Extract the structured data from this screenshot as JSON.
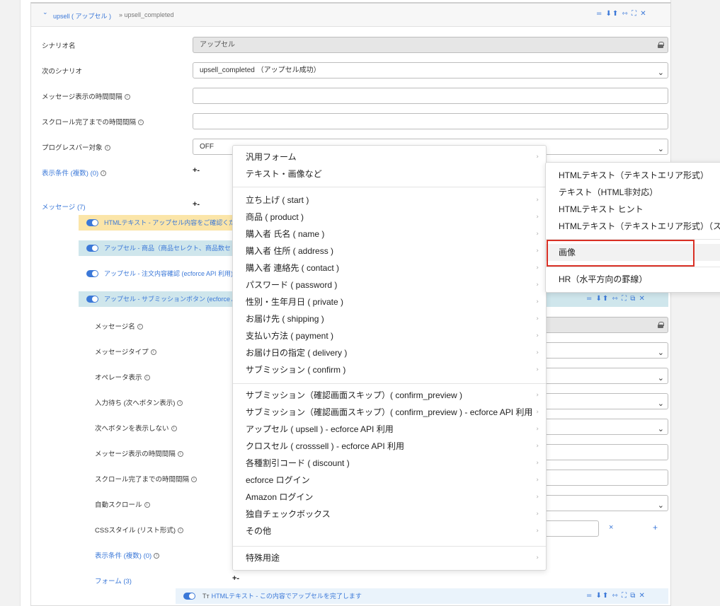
{
  "header": {
    "title": "upsell ( アップセル )",
    "sub": "» upsell_completed",
    "icons": "= ⬇⬆ ⇿ ⛶ ✕"
  },
  "fields": {
    "scenario_name_label": "シナリオ名",
    "scenario_name_value": "アップセル",
    "next_scenario_label": "次のシナリオ",
    "next_scenario_value": "upsell_completed （アップセル成功）",
    "msg_interval_label": "メッセージ表示の時間間隔",
    "scroll_interval_label": "スクロール完了までの時間間隔",
    "progress_label": "プログレスバー対象",
    "progress_value": "OFF",
    "display_cond_label": "表示条件 (複数) (0)",
    "messages_label": "メッセージ (7)"
  },
  "messages": [
    {
      "text": "HTMLテキスト - アップセル内容をご確認くだ",
      "bg": "#fbe5a8"
    },
    {
      "text": "アップセル - 商品（商品セレクト、商品数セレ",
      "bg": "#cfe6ec"
    },
    {
      "text": "アップセル - 注文内容確認 (ecforce API 利用)",
      "bg": "#ffffff"
    },
    {
      "text": "アップセル - サブミッションボタン (ecforce A",
      "bg": "#cfe6ec"
    }
  ],
  "detail": {
    "msg_name": "メッセージ名",
    "msg_type": "メッセージタイプ",
    "operator": "オペレータ表示",
    "wait_input": "入力待ち (次へボタン表示)",
    "hide_next": "次へボタンを表示しない",
    "msg_interval": "メッセージ表示の時間間隔",
    "scroll_interval": "スクロール完了までの時間間隔",
    "auto_scroll": "自動スクロール",
    "css_style": "CSSスタイル (リスト形式)",
    "display_cond": "表示条件 (複数) (0)",
    "form": "フォーム (3)",
    "css_x": "×",
    "css_plus": "+"
  },
  "bottom_bar": {
    "text": "HTMLテキスト - この内容でアップセルを完了します",
    "prefix": "Tт"
  },
  "menu": {
    "group1": [
      "汎用フォーム",
      "テキスト・画像など"
    ],
    "group2": [
      "立ち上げ ( start )",
      "商品 ( product )",
      "購入者 氏名 ( name )",
      "購入者 住所 ( address )",
      "購入者 連絡先 ( contact )",
      "パスワード ( password )",
      "性別・生年月日 ( private )",
      "お届け先 ( shipping )",
      "支払い方法 ( payment )",
      "お届け日の指定 ( delivery )",
      "サブミッション ( confirm )"
    ],
    "group3": [
      "サブミッション（確認画面スキップ）( confirm_preview )",
      "サブミッション（確認画面スキップ）( confirm_preview ) - ecforce API 利用",
      "アップセル ( upsell ) - ecforce API 利用",
      "クロスセル ( crosssell ) - ecforce API 利用",
      "各種割引コード ( discount )",
      "ecforce ログイン",
      "Amazon ログイン",
      "独自チェックボックス",
      "その他"
    ],
    "group4": [
      "特殊用途"
    ]
  },
  "submenu": {
    "items": [
      "HTMLテキスト（テキストエリア形式）",
      "テキスト（HTML非対応）",
      "HTMLテキスト ヒント",
      "HTMLテキスト（テキストエリア形式）（ス"
    ],
    "selected": "画像",
    "last": "HR（水平方向の罫線）"
  },
  "colors": {
    "accent": "#3b78d8",
    "highlight": "#d93025"
  }
}
